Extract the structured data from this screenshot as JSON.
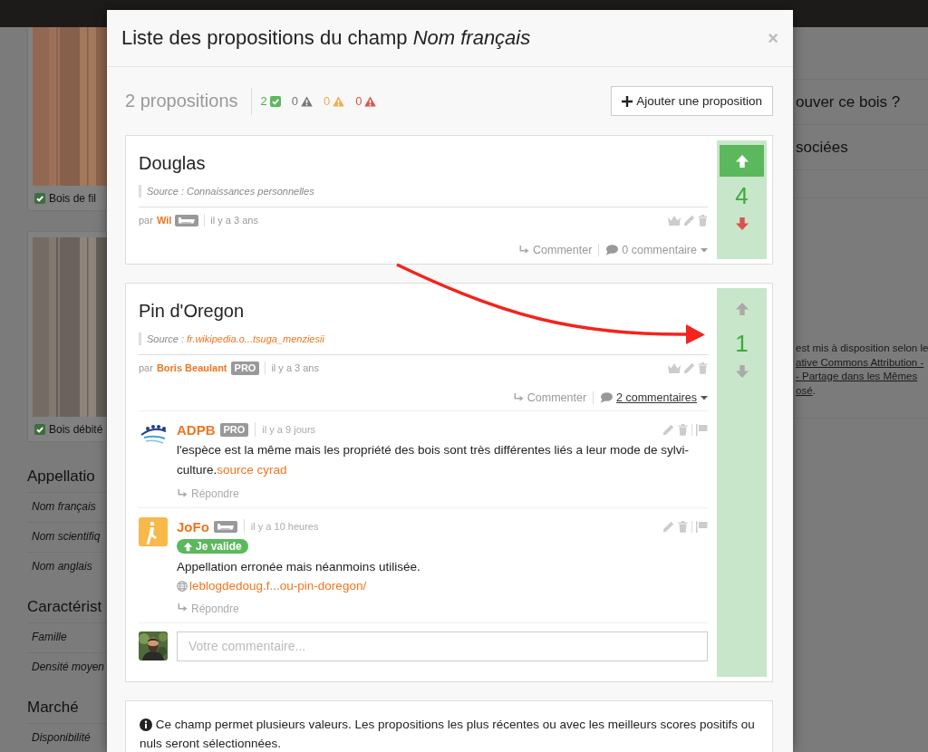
{
  "background": {
    "photos": [
      {
        "caption": "Bois de fil",
        "checked": true
      },
      {
        "caption": "Bois débité",
        "checked": true
      }
    ],
    "sections": [
      {
        "heading": "Appellatio",
        "rows": [
          "Nom français",
          "Nom scientifiq",
          "Nom anglais"
        ]
      },
      {
        "heading": "Caractérist",
        "rows": [
          "Famille",
          "Densité moyen"
        ]
      },
      {
        "heading": "Marché",
        "rows": [
          "Disponibilité"
        ]
      }
    ],
    "right_items": [
      "ouver ce bois ?",
      "sociées"
    ],
    "license_lines": [
      [
        {
          "text": "est mis à disposition selon le",
          "link": false
        }
      ],
      [
        {
          "text": "ative Commons Attribution -",
          "link": true
        }
      ],
      [
        {
          "text": "- Partage dans les Mêmes",
          "link": true
        }
      ],
      [
        {
          "text": "osé",
          "link": true
        },
        {
          "text": ".",
          "link": false
        }
      ]
    ]
  },
  "modal": {
    "title": "Liste des propositions du champ *Nom français*",
    "close": "×",
    "count_label": "2 propositions",
    "counters": [
      {
        "kind": "valid",
        "count": "2"
      },
      {
        "kind": "neutral",
        "count": "0"
      },
      {
        "kind": "warning",
        "count": "0"
      },
      {
        "kind": "danger",
        "count": "0"
      }
    ],
    "add_button": "Ajouter une proposition",
    "proposals": [
      {
        "title": "Douglas",
        "source_prefix": "Source :",
        "source": {
          "kind": "text",
          "text": "Connaissances personnelles"
        },
        "by": "par",
        "author": "Wil",
        "badge": {
          "kind": "saw"
        },
        "time": "il y a 3 ans",
        "comment_action": "Commenter",
        "comments_label": "0 commentaire",
        "expanded": false,
        "score": "4",
        "upvoted": true
      },
      {
        "title": "Pin d'Oregon",
        "source_prefix": "Source :",
        "source": {
          "kind": "link",
          "text": "fr.wikipedia.o...tsuga_menziesii"
        },
        "by": "par",
        "author": "Boris Beaulant",
        "badge": {
          "kind": "pro",
          "label": "PRO"
        },
        "time": "il y a 3 ans",
        "comment_action": "Commenter",
        "comments_label": "2 commentaires",
        "expanded": true,
        "score": "1",
        "upvoted": false,
        "comments": [
          {
            "avatar": {
              "kind": "logo"
            },
            "author": "ADPB",
            "badge": {
              "kind": "pro",
              "label": "PRO"
            },
            "time": "il y a 9 jours",
            "text": "l'espèce est la même mais les propriété des bois sont très différentes liés a leur mode de sylvi-culture.",
            "link": {
              "kind": "inline",
              "text": "source cyrad"
            },
            "reply": "Répondre"
          },
          {
            "avatar": {
              "kind": "figure"
            },
            "author": "JoFo",
            "badge": {
              "kind": "saw"
            },
            "time": "il y a 10 heures",
            "endorsement": "Je valide",
            "text": "Appellation erronée mais néanmoins utilisée.",
            "link": {
              "kind": "web",
              "text": "leblogdedoug.f...ou-pin-doregon/"
            },
            "reply": "Répondre"
          }
        ],
        "comment_box": {
          "placeholder": "Votre commentaire..."
        }
      }
    ],
    "info": "Ce champ permet plusieurs valeurs. Les propositions les plus récentes ou avec les meilleurs scores positifs ou nuls seront sélectionnées."
  },
  "annotations": [
    {
      "kind": "arrow"
    }
  ]
}
